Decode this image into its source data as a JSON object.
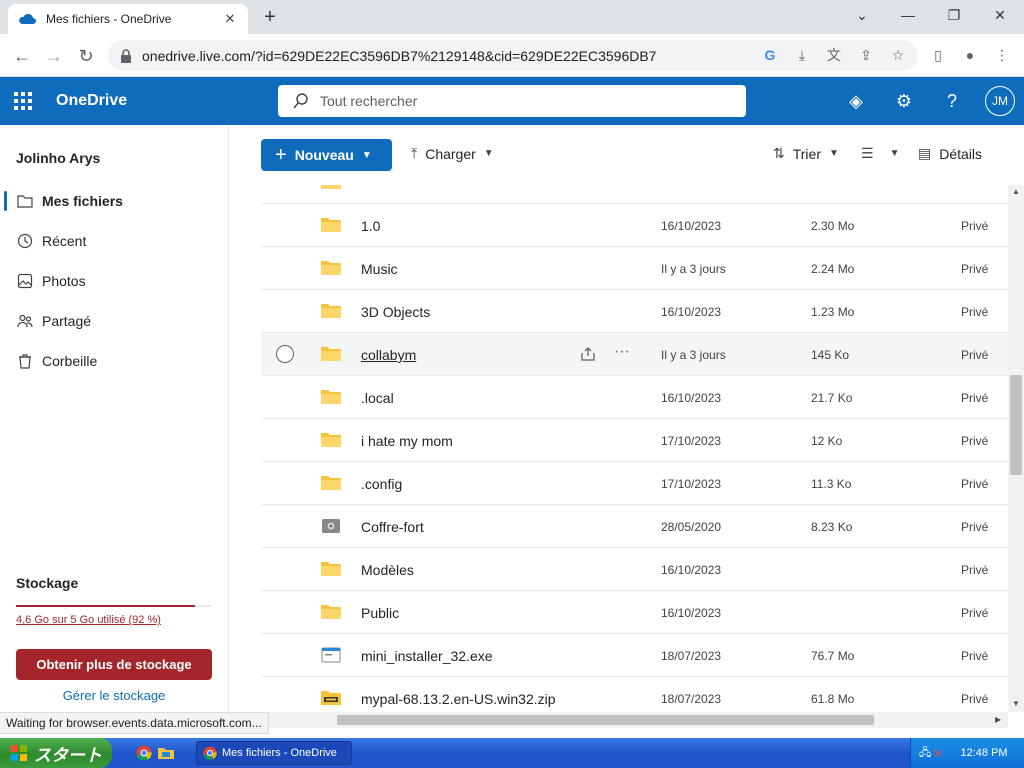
{
  "browser": {
    "tab_title": "Mes fichiers - OneDrive",
    "url": "onedrive.live.com/?id=629DE22EC3596DB7%2129148&cid=629DE22EC3596DB7"
  },
  "header": {
    "brand": "OneDrive",
    "search_placeholder": "Tout rechercher",
    "avatar_initials": "JM",
    "accent_color": "#0f6cbd"
  },
  "sidebar": {
    "user_name": "Jolinho Arys",
    "items": [
      {
        "label": "Mes fichiers",
        "icon": "folder-icon",
        "active": true
      },
      {
        "label": "Récent",
        "icon": "clock-icon",
        "active": false
      },
      {
        "label": "Photos",
        "icon": "photo-icon",
        "active": false
      },
      {
        "label": "Partagé",
        "icon": "people-icon",
        "active": false
      },
      {
        "label": "Corbeille",
        "icon": "recycle-bin-icon",
        "active": false
      }
    ],
    "storage": {
      "title": "Stockage",
      "usage_text": "4,6 Go sur 5 Go utilisé (92 %)",
      "used_fraction": 0.92,
      "buy_button": "Obtenir plus de stockage",
      "manage_link": "Gérer le stockage",
      "warning_color": "#a4262c"
    }
  },
  "commands": {
    "new": "Nouveau",
    "upload": "Charger",
    "sort": "Trier",
    "details": "Détails"
  },
  "files": [
    {
      "name": "1.0",
      "type": "folder",
      "modified": "16/10/2023",
      "size": "2.30 Mo",
      "sharing": "Privé"
    },
    {
      "name": "Music",
      "type": "folder",
      "modified": "Il y a 3 jours",
      "size": "2.24 Mo",
      "sharing": "Privé"
    },
    {
      "name": "3D Objects",
      "type": "folder",
      "modified": "16/10/2023",
      "size": "1.23 Mo",
      "sharing": "Privé"
    },
    {
      "name": "collabym",
      "type": "folder",
      "modified": "Il y a 3 jours",
      "size": "145 Ko",
      "sharing": "Privé"
    },
    {
      "name": ".local",
      "type": "folder",
      "modified": "16/10/2023",
      "size": "21.7 Ko",
      "sharing": "Privé"
    },
    {
      "name": "i hate my mom",
      "type": "folder",
      "modified": "17/10/2023",
      "size": "12 Ko",
      "sharing": "Privé"
    },
    {
      "name": ".config",
      "type": "folder",
      "modified": "17/10/2023",
      "size": "11.3 Ko",
      "sharing": "Privé"
    },
    {
      "name": "Coffre-fort",
      "type": "vault",
      "modified": "28/05/2020",
      "size": "8.23 Ko",
      "sharing": "Privé"
    },
    {
      "name": "Modèles",
      "type": "folder",
      "modified": "16/10/2023",
      "size": "",
      "sharing": "Privé"
    },
    {
      "name": "Public",
      "type": "folder",
      "modified": "16/10/2023",
      "size": "",
      "sharing": "Privé"
    },
    {
      "name": "mini_installer_32.exe",
      "type": "exe",
      "modified": "18/07/2023",
      "size": "76.7 Mo",
      "sharing": "Privé"
    },
    {
      "name": "mypal-68.13.2.en-US.win32.zip",
      "type": "zip",
      "modified": "18/07/2023",
      "size": "61.8 Mo",
      "sharing": "Privé"
    }
  ],
  "status_text": "Waiting for browser.events.data.microsoft.com...",
  "taskbar": {
    "start_label": "スタート",
    "window_button": "Mes fichiers - OneDrive",
    "clock": "12:48 PM"
  }
}
